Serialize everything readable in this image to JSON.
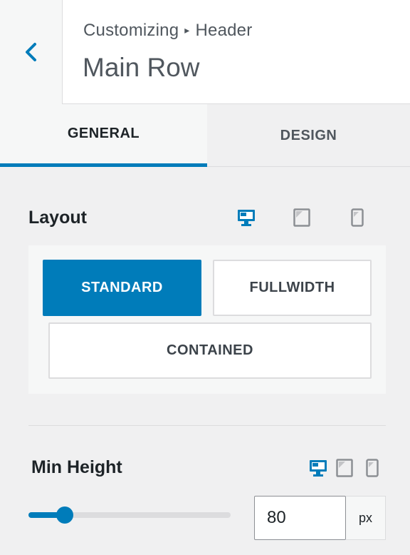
{
  "header": {
    "breadcrumb_parent": "Customizing",
    "breadcrumb_separator": "▸",
    "breadcrumb_current": "Header",
    "title": "Main Row",
    "back_icon": "chevron-left-icon"
  },
  "tabs": [
    {
      "label": "GENERAL",
      "active": true
    },
    {
      "label": "DESIGN",
      "active": false
    }
  ],
  "layout": {
    "label": "Layout",
    "active_device": "desktop",
    "options": [
      {
        "label": "STANDARD",
        "selected": true
      },
      {
        "label": "FULLWIDTH",
        "selected": false
      },
      {
        "label": "CONTAINED",
        "selected": false
      }
    ]
  },
  "min_height": {
    "label": "Min Height",
    "active_device": "desktop",
    "value": "80",
    "unit": "px",
    "slider_fraction": 0.18
  },
  "colors": {
    "accent": "#007cba",
    "inactive_icon": "#8c8f94",
    "border": "#dcdcde"
  }
}
